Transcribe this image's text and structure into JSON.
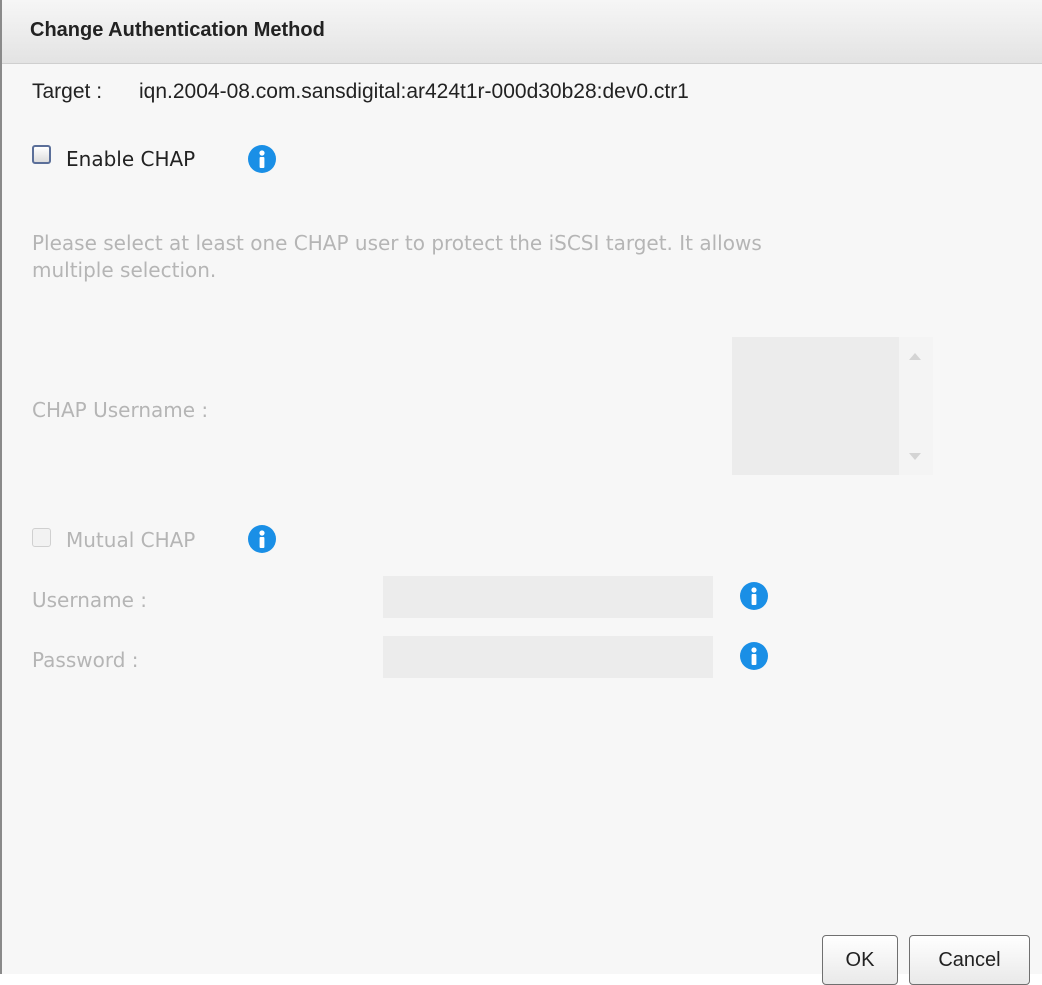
{
  "dialog": {
    "title": "Change Authentication Method"
  },
  "target": {
    "label": "Target :",
    "value": "iqn.2004-08.com.sansdigital:ar424t1r-000d30b28:dev0.ctr1"
  },
  "enable_chap": {
    "label": "Enable CHAP",
    "checked": false,
    "info_icon": "info-icon"
  },
  "help_text": "Please select at least one CHAP user to protect the iSCSI target. It allows multiple selection.",
  "chap_username": {
    "label": "CHAP Username :",
    "options": []
  },
  "mutual_chap": {
    "label": "Mutual CHAP",
    "checked": false,
    "info_icon": "info-icon"
  },
  "username": {
    "label": "Username :",
    "value": "",
    "info_icon": "info-icon"
  },
  "password": {
    "label": "Password :",
    "value": "",
    "info_icon": "info-icon"
  },
  "buttons": {
    "ok": "OK",
    "cancel": "Cancel"
  },
  "colors": {
    "info_icon": "#1a8fe6",
    "disabled_text": "#b5b5b5",
    "dialog_background": "#f7f7f7"
  }
}
